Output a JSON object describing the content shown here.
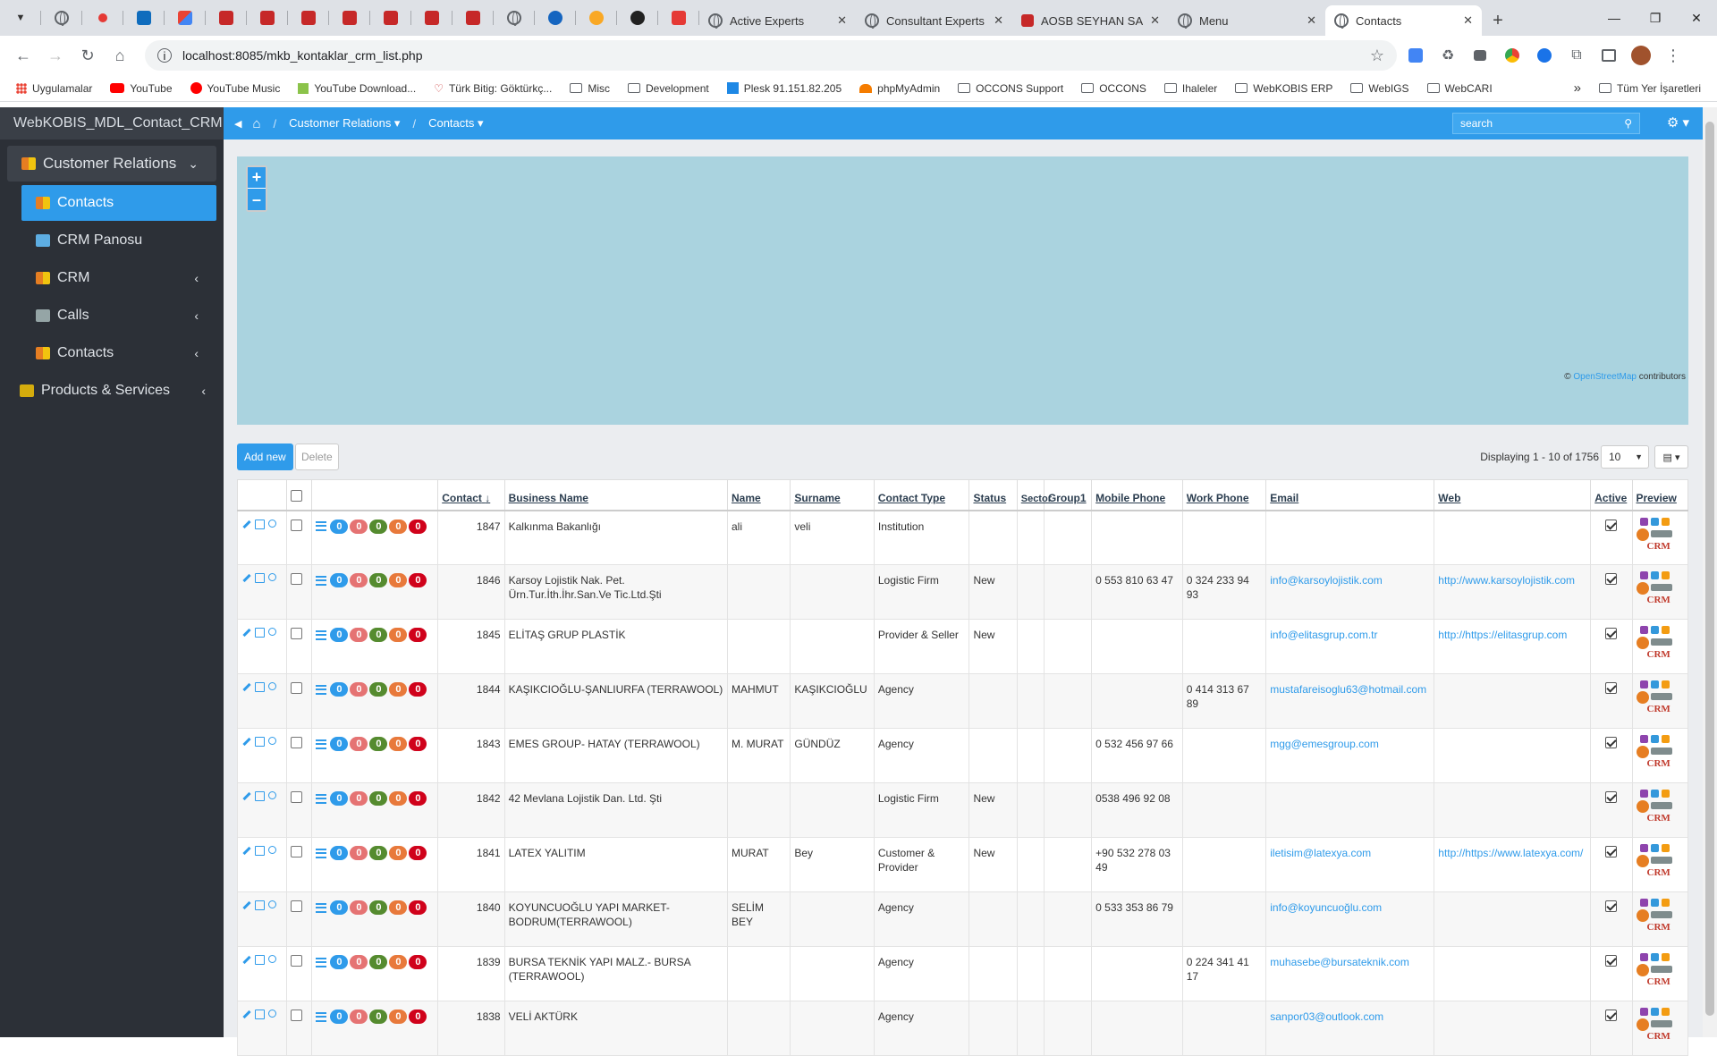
{
  "browser": {
    "tabs": [
      {
        "title": "Active Experts"
      },
      {
        "title": "Consultant Experts"
      },
      {
        "title": "AOSB SEYHAN SAL"
      },
      {
        "title": "Menu"
      },
      {
        "title": "Contacts"
      }
    ],
    "url": "localhost:8085/mkb_kontaklar_crm_list.php",
    "bookmarks": [
      "Uygulamalar",
      "YouTube",
      "YouTube Music",
      "YouTube Download...",
      "Türk Bitig: Göktürkç...",
      "Misc",
      "Development",
      "Plesk 91.151.82.205",
      "phpMyAdmin",
      "OCCONS Support",
      "OCCONS",
      "Ihaleler",
      "WebKOBIS ERP",
      "WebIGS",
      "WebCARI"
    ],
    "bookmarks_more": "»",
    "bookmarks_all": "Tüm Yer İşaretleri"
  },
  "sidebar": {
    "brand": "WebKOBIS_MDL_Contact_CRM",
    "items": [
      {
        "label": "Customer Relations"
      },
      {
        "label": "Contacts"
      },
      {
        "label": "CRM Panosu"
      },
      {
        "label": "CRM"
      },
      {
        "label": "Calls"
      },
      {
        "label": "Contacts"
      },
      {
        "label": "Products & Services"
      }
    ]
  },
  "topnav": {
    "crumb1": "Customer Relations",
    "crumb2": "Contacts",
    "search_placeholder": "search"
  },
  "map": {
    "zoom_in": "+",
    "zoom_out": "–",
    "attribution_prefix": "©",
    "attribution_link": "OpenStreetMap",
    "attribution_suffix": "contributors"
  },
  "toolbar": {
    "add_label": "Add new",
    "delete_label": "Delete",
    "display_text": "Displaying 1 - 10 of 1756",
    "page_size": "10"
  },
  "table": {
    "headers": [
      "Contact",
      "Business Name",
      "Name",
      "Surname",
      "Contact Type",
      "Status",
      "Sector",
      "Group1",
      "Mobile Phone",
      "Work Phone",
      "Email",
      "Web",
      "Active",
      "Preview"
    ],
    "badge_colors": [
      "#2f9bea",
      "#e57373",
      "#558b2f",
      "#e8793b",
      "#d0021b"
    ],
    "badge_values": [
      "0",
      "0",
      "0",
      "0",
      "0"
    ],
    "preview_text": "CRM",
    "rows": [
      {
        "id": "1847",
        "business": "Kalkınma Bakanlığı",
        "name": "ali",
        "surname": "veli",
        "type": "Institution",
        "status": "",
        "mobile": "",
        "work": "",
        "email": "",
        "web": ""
      },
      {
        "id": "1846",
        "business": "Karsoy Lojistik Nak. Pet. Ürn.Tur.İth.İhr.San.Ve Tic.Ltd.Şti",
        "name": "",
        "surname": "",
        "type": "Logistic Firm",
        "status": "New",
        "mobile": "0 553 810 63 47",
        "work": "0 324 233 94 93",
        "email": "info@karsoylojistik.com",
        "web": "http://www.karsoylojistik.com"
      },
      {
        "id": "1845",
        "business": "ELİTAŞ GRUP PLASTİK",
        "name": "",
        "surname": "",
        "type": "Provider & Seller",
        "status": "New",
        "mobile": "",
        "work": "",
        "email": "info@elitasgrup.com.tr",
        "web": "http://https://elitasgrup.com"
      },
      {
        "id": "1844",
        "business": "KAŞIKCIOĞLU-ŞANLIURFA (TERRAWOOL)",
        "name": "MAHMUT",
        "surname": "KAŞIKCIOĞLU",
        "type": "Agency",
        "status": "",
        "mobile": "",
        "work": "0 414 313 67 89",
        "email": "mustafareisoglu63@hotmail.com",
        "web": ""
      },
      {
        "id": "1843",
        "business": "EMES GROUP- HATAY (TERRAWOOL)",
        "name": "M. MURAT",
        "surname": "GÜNDÜZ",
        "type": "Agency",
        "status": "",
        "mobile": "0 532 456 97 66",
        "work": "",
        "email": "mgg@emesgroup.com",
        "web": ""
      },
      {
        "id": "1842",
        "business": "42 Mevlana Lojistik Dan. Ltd. Şti",
        "name": "",
        "surname": "",
        "type": "Logistic Firm",
        "status": "New",
        "mobile": "0538 496 92 08",
        "work": "",
        "email": "",
        "web": ""
      },
      {
        "id": "1841",
        "business": "LATEX YALITIM",
        "name": "MURAT",
        "surname": "Bey",
        "type": "Customer & Provider",
        "status": "New",
        "mobile": "+90 532 278 03 49",
        "work": "",
        "email": "iletisim@latexya.com",
        "web": "http://https://www.latexya.com/"
      },
      {
        "id": "1840",
        "business": "KOYUNCUOĞLU YAPI MARKET-BODRUM(TERRAWOOL)",
        "name": "SELİM BEY",
        "surname": "",
        "type": "Agency",
        "status": "",
        "mobile": "0 533 353 86 79",
        "work": "",
        "email": "info@koyuncuoğlu.com",
        "web": ""
      },
      {
        "id": "1839",
        "business": "BURSA TEKNİK YAPI MALZ.- BURSA (TERRAWOOL)",
        "name": "",
        "surname": "",
        "type": "Agency",
        "status": "",
        "mobile": "",
        "work": "0 224 341 41 17",
        "email": "muhasebe@bursateknik.com",
        "web": ""
      },
      {
        "id": "1838",
        "business": "VELİ AKTÜRK",
        "name": "",
        "surname": "",
        "type": "Agency",
        "status": "",
        "mobile": "",
        "work": "",
        "email": "sanpor03@outlook.com",
        "web": ""
      }
    ]
  }
}
